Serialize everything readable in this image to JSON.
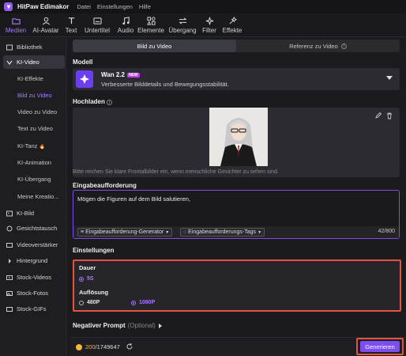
{
  "app": {
    "title": "HitPaw Edimakor",
    "menu": [
      "Datei",
      "Einstellungen",
      "Hilfe"
    ]
  },
  "toolbar": {
    "items": [
      {
        "label": "Medien",
        "icon": "folder-icon",
        "active": true
      },
      {
        "label": "AI-Avatar",
        "icon": "avatar-icon",
        "active": false
      },
      {
        "label": "Text",
        "icon": "text-icon",
        "active": false
      },
      {
        "label": "Untertitel",
        "icon": "subtitle-icon",
        "active": false
      },
      {
        "label": "Audio",
        "icon": "audio-icon",
        "active": false
      },
      {
        "label": "Elemente",
        "icon": "elements-icon",
        "active": false
      },
      {
        "label": "Übergang",
        "icon": "transition-icon",
        "active": false
      },
      {
        "label": "Filter",
        "icon": "filter-icon",
        "active": false
      },
      {
        "label": "Effekte",
        "icon": "effects-icon",
        "active": false
      }
    ]
  },
  "sidebar": {
    "library": "Bibliothek",
    "ki_video": "KI-Video",
    "sub": [
      "KI-Effekte",
      "Bild zu Video",
      "Video zu Video",
      "Text zu Video",
      "KI-Tanz",
      "KI-Animation",
      "KI-Übergang",
      "Meine Kreatio..."
    ],
    "others": [
      "KI-Bild",
      "Gesichtstausch",
      "Videoverstärker",
      "Hintergrund",
      "Stock-Videos",
      "Stock-Fotos",
      "Stock-GIFs"
    ],
    "fire_icon": "🔥"
  },
  "tabs": {
    "image_to_video": "Bild zu Video",
    "reference_to_video": "Referenz zu Video",
    "info": "i"
  },
  "model": {
    "label": "Modell",
    "name": "Wan 2.2",
    "badge": "NEW",
    "desc": "Verbesserte Bilddetails und Bewegungsstabilität."
  },
  "upload": {
    "label": "Hochladen",
    "info": "i",
    "hint": "Bitte reichen Sie klare Frontalbilder ein, wenn menschliche Gesichter zu sehen sind."
  },
  "prompt": {
    "label": "Eingabeaufforderung",
    "text": "Mögen die Figuren auf dem Bild salutieren,",
    "generator": "Eingabeaufforderung-Generator",
    "tags": "Eingabeaufforderungs-Tags",
    "counter": "42/800"
  },
  "settings": {
    "label": "Einstellungen",
    "duration_label": "Dauer",
    "duration_value": "5S",
    "resolution_label": "Auflösung",
    "res_options": [
      "480P",
      "1080P"
    ],
    "res_selected": "1080P"
  },
  "negative": {
    "label": "Negativer Prompt",
    "optional": "(Optional)"
  },
  "footer": {
    "credits_current": "200",
    "credits_total": "/1749647",
    "generate": "Generieren"
  },
  "colors": {
    "accent": "#a67cff",
    "button": "#7b4ef0",
    "highlight": "#e5533d",
    "coin": "#f4b73a"
  }
}
